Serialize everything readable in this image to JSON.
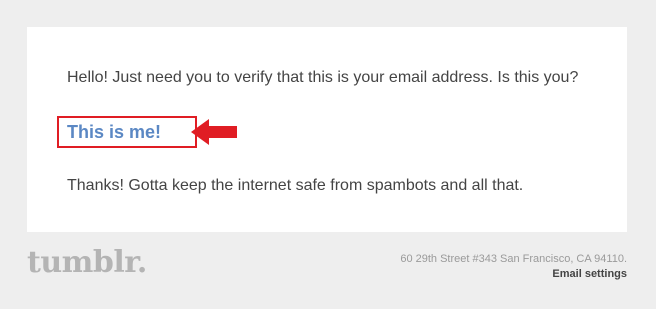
{
  "email": {
    "intro_text": "Hello! Just need you to verify that this is your email address. Is this you?",
    "confirm_link_label": "This is me!",
    "thanks_text": "Thanks! Gotta keep the internet safe from spambots and all that."
  },
  "footer": {
    "logo_text": "tumblr.",
    "address": "60 29th Street #343 San Francisco, CA 94110.",
    "settings_link": "Email settings"
  },
  "colors": {
    "background": "#eeeeee",
    "card": "#ffffff",
    "link": "#5b88c4",
    "highlight": "#e01d24",
    "logo": "#b4b4b4"
  },
  "icons": {
    "annotation_arrow": "arrow-left-icon"
  }
}
